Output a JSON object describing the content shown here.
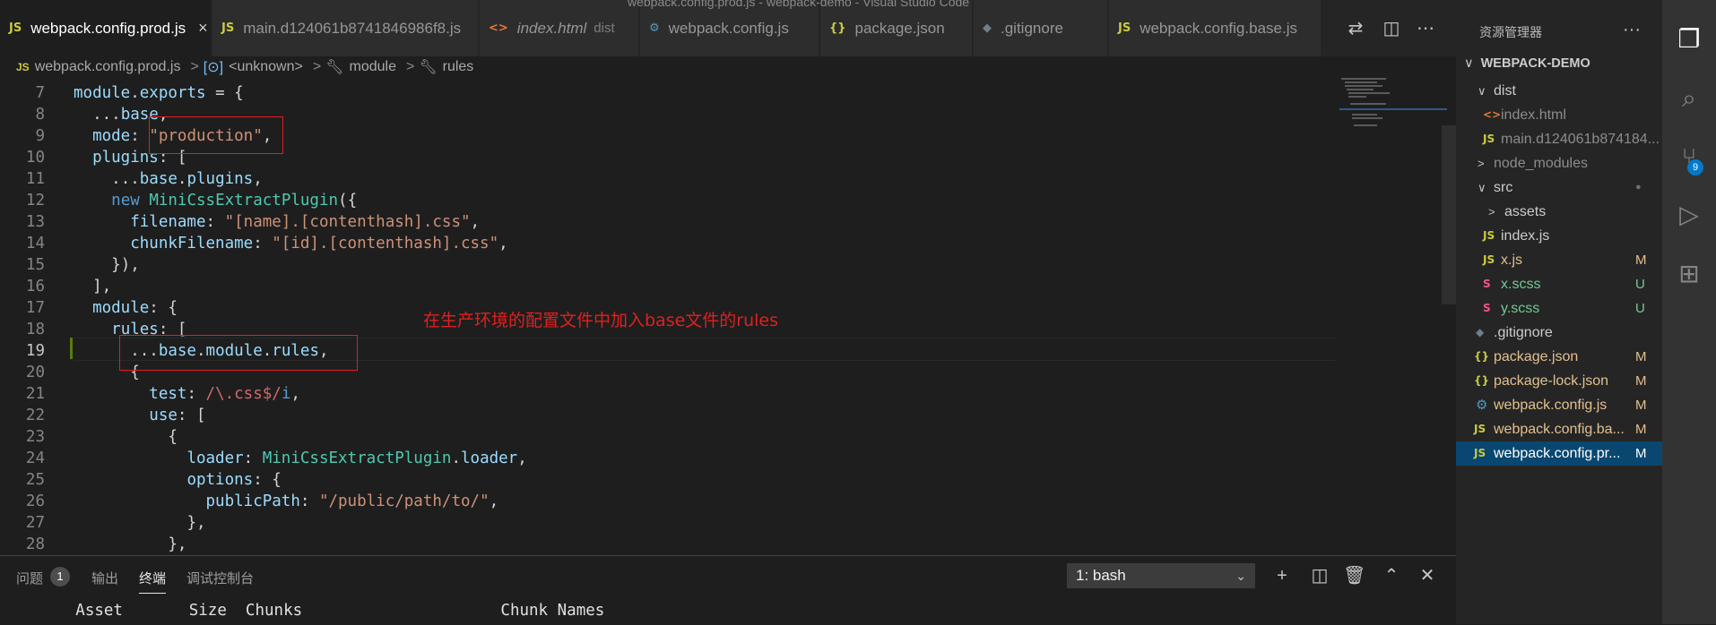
{
  "window_title": "webpack.config.prod.js - webpack-demo - Visual Studio Code",
  "tabs": [
    {
      "icon": "JS",
      "label": "webpack.config.prod.js",
      "active": true,
      "close": "×"
    },
    {
      "icon": "JS",
      "label": "main.d124061b8741846986f8.js"
    },
    {
      "icon": "<>",
      "label": "index.html",
      "desc": "dist"
    },
    {
      "icon": "⚙",
      "label": "webpack.config.js"
    },
    {
      "icon": "{}",
      "label": "package.json"
    },
    {
      "icon": "◆",
      "label": ".gitignore"
    },
    {
      "icon": "JS",
      "label": "webpack.config.base.js"
    }
  ],
  "breadcrumb": {
    "file_icon": "JS",
    "file": "webpack.config.prod.js",
    "unknown": "<unknown>",
    "module": "module",
    "rules": "rules",
    "sep": ">"
  },
  "code_lines": [
    {
      "n": "7"
    },
    {
      "n": "8"
    },
    {
      "n": "9"
    },
    {
      "n": "10"
    },
    {
      "n": "11"
    },
    {
      "n": "12"
    },
    {
      "n": "13"
    },
    {
      "n": "14"
    },
    {
      "n": "15"
    },
    {
      "n": "16"
    },
    {
      "n": "17"
    },
    {
      "n": "18"
    },
    {
      "n": "19"
    },
    {
      "n": "20"
    },
    {
      "n": "21"
    },
    {
      "n": "22"
    },
    {
      "n": "23"
    },
    {
      "n": "24"
    },
    {
      "n": "25"
    },
    {
      "n": "26"
    },
    {
      "n": "27"
    },
    {
      "n": "28"
    }
  ],
  "code": {
    "l7": [
      "module",
      ".",
      "exports",
      " = {"
    ],
    "l8": [
      "...",
      "base",
      ","
    ],
    "l9": [
      "mode",
      ": ",
      "\"production\"",
      ","
    ],
    "l10": [
      "plugins",
      ": ["
    ],
    "l11": [
      "...",
      "base",
      ".",
      "plugins",
      ","
    ],
    "l12": [
      "new ",
      "MiniCssExtractPlugin",
      "({"
    ],
    "l13": [
      "filename",
      ": ",
      "\"[name].[contenthash].css\"",
      ","
    ],
    "l14": [
      "chunkFilename",
      ": ",
      "\"[id].[contenthash].css\"",
      ","
    ],
    "l15": [
      "}),"
    ],
    "l16": [
      "],"
    ],
    "l17": [
      "module",
      ": {"
    ],
    "l18": [
      "rules",
      ": ["
    ],
    "l19": [
      "...",
      "base",
      ".",
      "module",
      ".",
      "rules",
      ","
    ],
    "l20": [
      "{"
    ],
    "l21": [
      "test",
      ": ",
      "/\\.css$/",
      "i",
      ","
    ],
    "l22": [
      "use",
      ": ["
    ],
    "l23": [
      "{"
    ],
    "l24": [
      "loader",
      ": ",
      "MiniCssExtractPlugin",
      ".",
      "loader",
      ","
    ],
    "l25": [
      "options",
      ": {"
    ],
    "l26": [
      "publicPath",
      ": ",
      "\"/public/path/to/\"",
      ","
    ],
    "l27": [
      "},"
    ],
    "l28": [
      "},"
    ]
  },
  "annotation": "在生产环境的配置文件中加入base文件的rules",
  "panel": {
    "tabs": [
      "问题",
      "输出",
      "终端",
      "调试控制台"
    ],
    "problems_count": "1",
    "terminal_select": "1: bash",
    "terminal_header": "        Asset       Size  Chunks                     Chunk Names"
  },
  "sidebar": {
    "title": "资源管理器",
    "more": "···",
    "project": "WEBPACK-DEMO",
    "items": [
      {
        "label": "dist",
        "twist": "∨",
        "status": ""
      },
      {
        "label": "index.html",
        "icon": "<>",
        "status": ""
      },
      {
        "label": "main.d124061b874184...",
        "icon": "JS",
        "status": ""
      },
      {
        "label": "node_modules",
        "twist": ">",
        "status": ""
      },
      {
        "label": "src",
        "twist": "∨",
        "status": "●"
      },
      {
        "label": "assets",
        "twist": ">",
        "status": ""
      },
      {
        "label": "index.js",
        "icon": "JS",
        "status": ""
      },
      {
        "label": "x.js",
        "icon": "JS",
        "status": "M"
      },
      {
        "label": "x.scss",
        "icon": "S",
        "status": "U"
      },
      {
        "label": "y.scss",
        "icon": "S",
        "status": "U"
      },
      {
        "label": ".gitignore",
        "icon": "◆",
        "status": ""
      },
      {
        "label": "package.json",
        "icon": "{}",
        "status": "M"
      },
      {
        "label": "package-lock.json",
        "icon": "{}",
        "status": "M"
      },
      {
        "label": "webpack.config.js",
        "icon": "⚙",
        "status": "M"
      },
      {
        "label": "webpack.config.ba...",
        "icon": "JS",
        "status": "M"
      },
      {
        "label": "webpack.config.pr...",
        "icon": "JS",
        "status": "M"
      }
    ]
  },
  "activity": {
    "scm_badge": "9"
  }
}
